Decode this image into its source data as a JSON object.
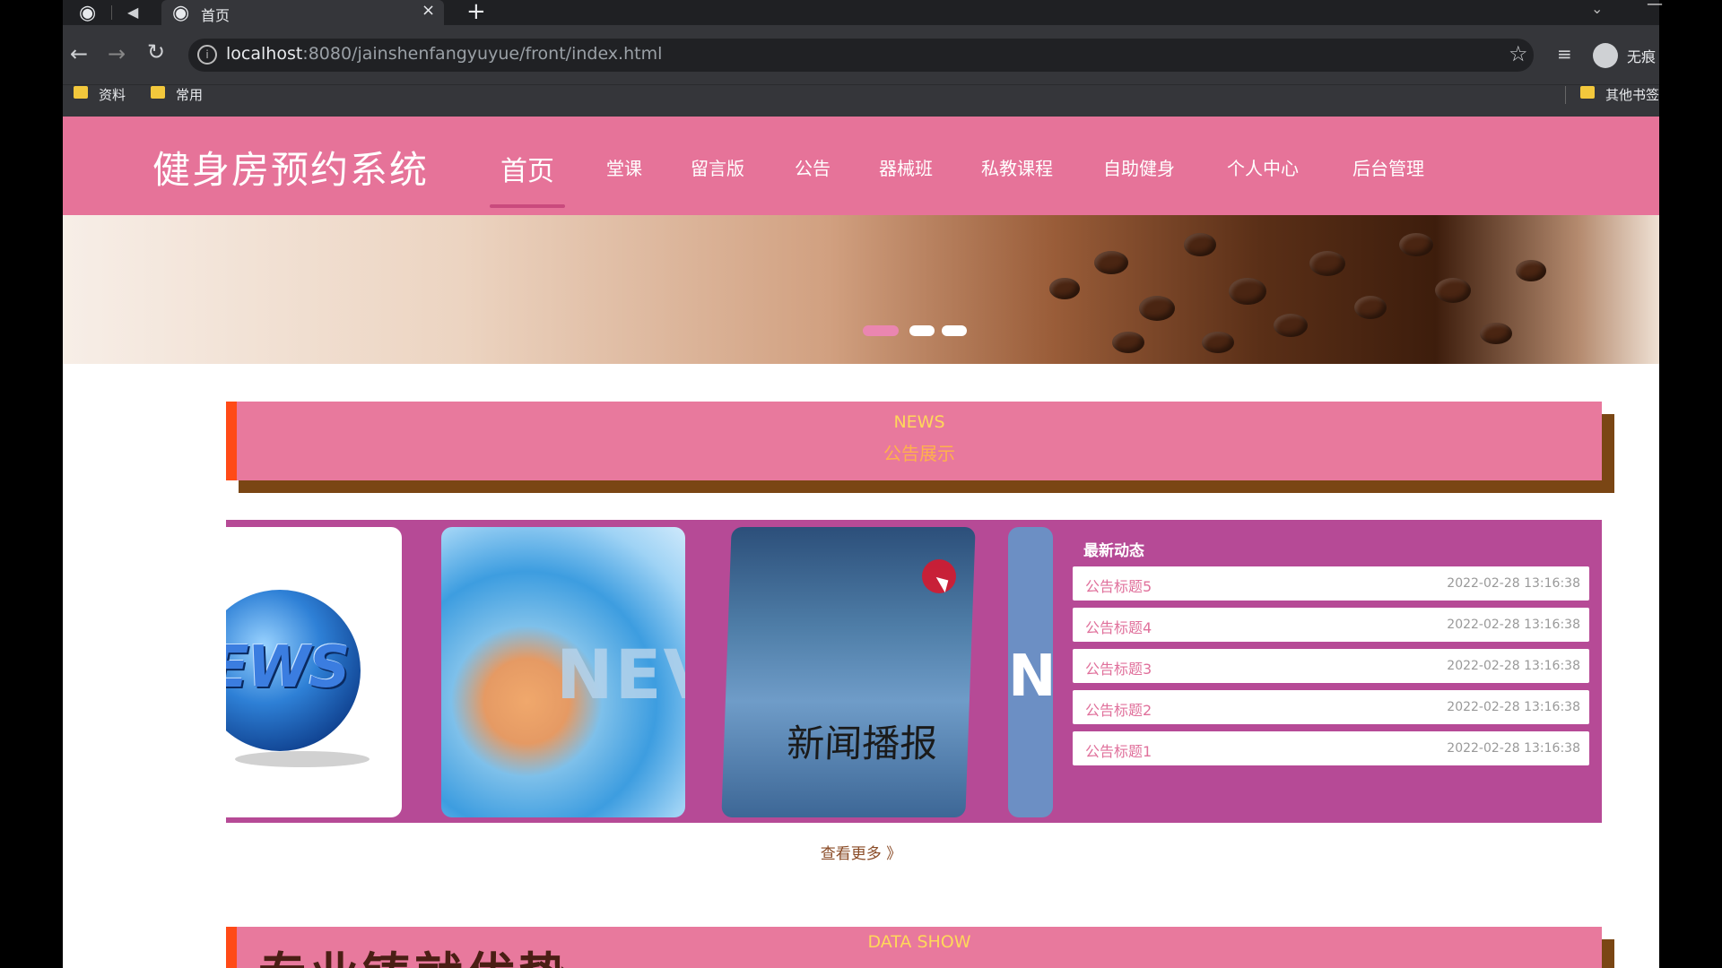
{
  "browser": {
    "tab_title": "首页",
    "tab_close": "×",
    "new_tab": "+",
    "url_host": "localhost",
    "url_path": ":8080/jainshenfangyuyue/front/index.html",
    "profile_name": "无痕",
    "bookmarks": [
      "资料",
      "常用"
    ],
    "other_bookmarks": "其他书签",
    "icons": {
      "back": "←",
      "forward": "→",
      "reload": "↻",
      "info": "i",
      "star": "☆",
      "media": "≡",
      "speaker": "◀",
      "globe": "◉",
      "chevron": "⌄",
      "minimize": "—"
    }
  },
  "site": {
    "title": "健身房预约系统",
    "nav": [
      "首页",
      "堂课",
      "留言版",
      "公告",
      "器械班",
      "私教课程",
      "自助健身",
      "个人中心",
      "后台管理"
    ]
  },
  "news_section": {
    "title_en": "NEWS",
    "title_cn": "公告展示",
    "card_texts": [
      "EWS",
      "NEV",
      "新闻播报",
      "N"
    ],
    "latest_title": "最新动态",
    "items": [
      {
        "title": "公告标题5",
        "time": "2022-02-28 13:16:38"
      },
      {
        "title": "公告标题4",
        "time": "2022-02-28 13:16:38"
      },
      {
        "title": "公告标题3",
        "time": "2022-02-28 13:16:38"
      },
      {
        "title": "公告标题2",
        "time": "2022-02-28 13:16:38"
      },
      {
        "title": "公告标题1",
        "time": "2022-02-28 13:16:38"
      }
    ],
    "view_more": "查看更多 》"
  },
  "data_section": {
    "title_en": "DATA SHOW",
    "big_text": "专业铸就优势"
  },
  "colors": {
    "header_pink": "#e67399",
    "panel_magenta": "#b64a96",
    "accent_orange": "#ff4a17",
    "shadow_brown": "#7a4614"
  }
}
